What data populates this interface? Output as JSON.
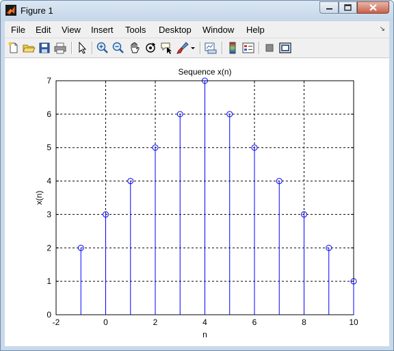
{
  "window": {
    "title": "Figure 1"
  },
  "menu": [
    "File",
    "Edit",
    "View",
    "Insert",
    "Tools",
    "Desktop",
    "Window",
    "Help"
  ],
  "toolbar": {
    "icons": [
      "new-figure-icon",
      "open-file-icon",
      "save-icon",
      "print-icon",
      "edit-plot-arrow-icon",
      "zoom-in-icon",
      "zoom-out-icon",
      "pan-hand-icon",
      "rotate-3d-icon",
      "data-cursor-icon",
      "brush-icon",
      "brush-dropdown-icon",
      "link-plot-icon",
      "colorbar-icon",
      "legend-icon",
      "hide-plot-tools-icon",
      "show-plot-tools-icon"
    ]
  },
  "chart_data": {
    "type": "stem",
    "title": "Sequence x(n)",
    "xlabel": "n",
    "ylabel": "x(n)",
    "xlim": [
      -2,
      10
    ],
    "ylim": [
      0,
      7
    ],
    "x_ticks": [
      "-2",
      "0",
      "2",
      "4",
      "6",
      "8",
      "10"
    ],
    "y_ticks": [
      "0",
      "1",
      "2",
      "3",
      "4",
      "5",
      "6",
      "7"
    ],
    "grid": true,
    "color": "#0000ff",
    "marker": "circle",
    "x": [
      -1,
      0,
      1,
      2,
      3,
      4,
      5,
      6,
      7,
      8,
      9,
      10
    ],
    "y": [
      2,
      3,
      4,
      5,
      6,
      7,
      6,
      5,
      4,
      3,
      2,
      1
    ]
  }
}
